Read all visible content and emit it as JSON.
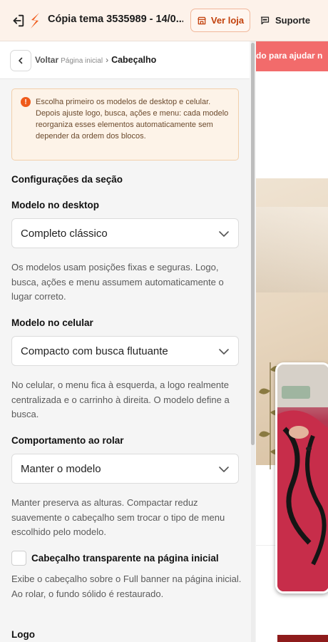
{
  "topbar": {
    "title": "Cópia tema 3535989 - 14/0...",
    "store_button": "Ver loja",
    "support_button": "Suporte"
  },
  "breadcrumb": {
    "back": "Voltar",
    "parent": "Página inicial",
    "current": "Cabeçalho"
  },
  "alert": {
    "text": "Escolha primeiro os modelos de desktop e celular. Depois ajuste logo, busca, ações e menu: cada modelo reorganiza esses elementos automaticamente sem depender da ordem dos blocos."
  },
  "section": {
    "title": "Configurações da seção",
    "desktop": {
      "label": "Modelo no desktop",
      "value": "Completo clássico",
      "help": "Os modelos usam posições fixas e seguras. Logo, busca, ações e menu assumem automaticamente o lugar correto."
    },
    "mobile": {
      "label": "Modelo no celular",
      "value": "Compacto com busca flutuante",
      "help": "No celular, o menu fica à esquerda, a logo realmente centralizada e o carrinho à direita. O modelo define a busca."
    },
    "scroll": {
      "label": "Comportamento ao rolar",
      "value": "Manter o modelo",
      "help": "Manter preserva as alturas. Compactar reduz suavemente o cabeçalho sem trocar o tipo de menu escolhido pelo modelo."
    },
    "transparent": {
      "label": "Cabeçalho transparente na página inicial",
      "checked": false,
      "help": "Exibe o cabeçalho sobre o Full banner na página inicial. Ao rolar, o fundo sólido é restaurado."
    },
    "logo_label": "Logo"
  },
  "preview": {
    "promo_text": "do para ajudar n"
  },
  "colors": {
    "accent": "#c2410c",
    "alert_bg": "#fdf3e8",
    "promo_bg": "#f26b6b"
  }
}
